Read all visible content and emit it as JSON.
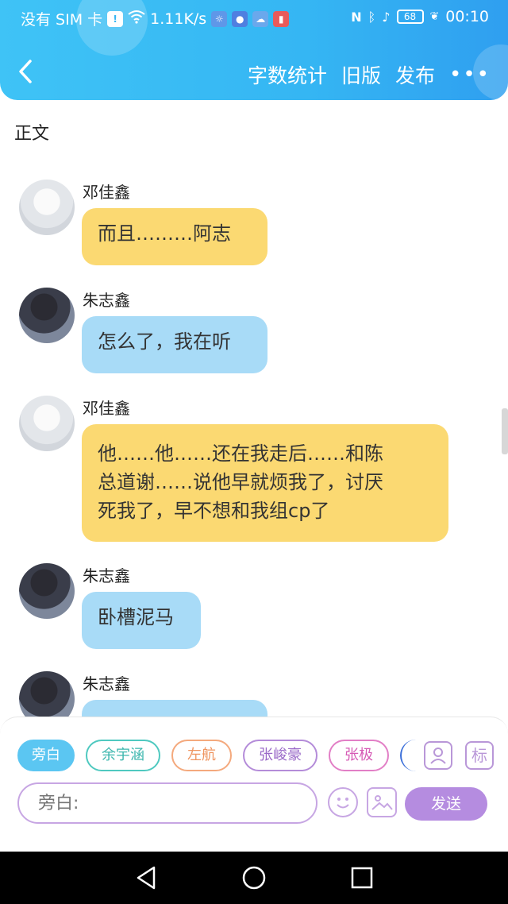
{
  "status_bar": {
    "carrier": "没有 SIM 卡",
    "speed": "1.11K/s",
    "battery": "68",
    "time": "00:10"
  },
  "header": {
    "back_icon": "chevron-left-icon",
    "actions": [
      "字数统计",
      "旧版",
      "发布"
    ],
    "more_label": "•••"
  },
  "section_title": "正文",
  "messages": [
    {
      "name": "邓佳鑫",
      "text": "而且………阿志",
      "color": "yellow"
    },
    {
      "name": "朱志鑫",
      "text": "怎么了，我在听",
      "color": "blue"
    },
    {
      "name": "邓佳鑫",
      "lines": [
        "他……他……还在我走后……和陈",
        "总道谢……说他早就烦我了，讨厌",
        "死我了，早不想和我组cp了"
      ],
      "color": "yellow"
    },
    {
      "name": "朱志鑫",
      "text": "卧槽泥马",
      "color": "blue"
    },
    {
      "name": "朱志鑫",
      "text": "",
      "color": "blue"
    }
  ],
  "composer": {
    "roles": [
      "旁白",
      "余宇涵",
      "左航",
      "张峻豪",
      "张极"
    ],
    "tag_label": "标",
    "placeholder": "旁白:",
    "send_label": "发送"
  },
  "colors": {
    "header": "#35b6f3",
    "yellow_bubble": "#fbd972",
    "blue_bubble": "#a8dbf7",
    "accent_purple": "#b58ce0"
  }
}
